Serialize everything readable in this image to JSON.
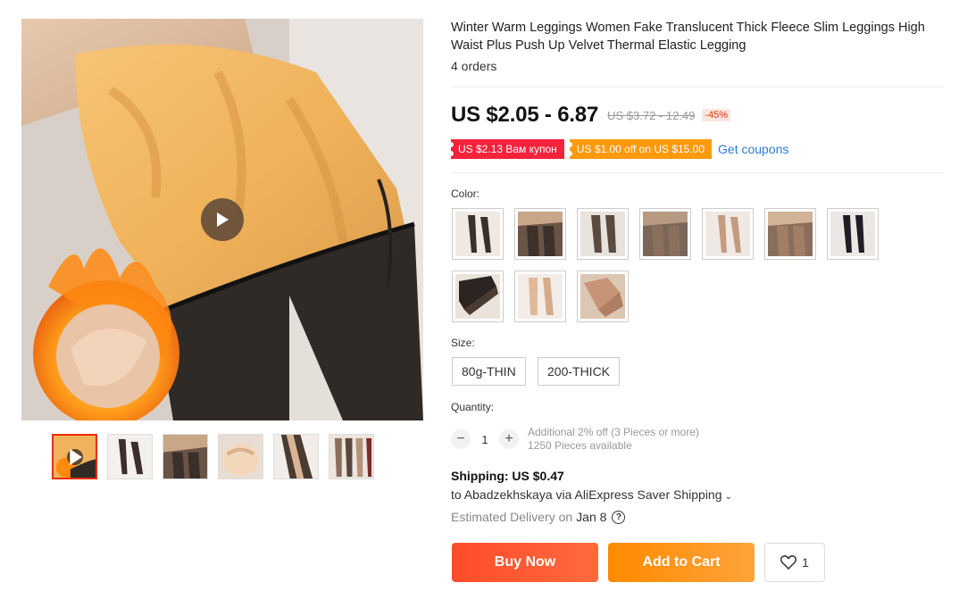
{
  "gallery": {
    "main_alt": "product-image",
    "thumbnail_count": 6
  },
  "product": {
    "title": "Winter Warm Leggings Women Fake Translucent Thick Fleece Slim Leggings High Waist Plus Push Up Velvet Thermal Elastic Legging",
    "orders": "4 orders",
    "price": "US $2.05 - 6.87",
    "old_price": "US $3.72 - 12.49",
    "discount": "-45%"
  },
  "coupons": {
    "coupon1": "US $2.13 Вам купон",
    "coupon2": "US $1.00 off on US $15.00",
    "get_coupons": "Get coupons"
  },
  "color": {
    "label": "Color:",
    "swatch_count": 10
  },
  "size": {
    "label": "Size:",
    "options": [
      "80g-THIN",
      "200-THICK"
    ]
  },
  "quantity": {
    "label": "Quantity:",
    "value": "1",
    "minus": "−",
    "plus": "+",
    "note1": "Additional 2% off (3 Pieces or more)",
    "note2": "1250 Pieces available"
  },
  "shipping": {
    "title": "Shipping: US $0.47",
    "destination": "to Abadzekhskaya via AliExpress Saver Shipping",
    "delivery_label": "Estimated Delivery on",
    "delivery_date": "Jan 8",
    "help": "?"
  },
  "actions": {
    "buy_now": "Buy Now",
    "add_to_cart": "Add to Cart",
    "wishlist_count": "1"
  },
  "colors": {
    "price_red": "#e62e04",
    "coupon_red": "#f5223c",
    "coupon_orange": "#ff9a0d",
    "link_blue": "#2e7cd6",
    "buy_now": "#ff4b2b",
    "add_to_cart": "#ff9500"
  }
}
